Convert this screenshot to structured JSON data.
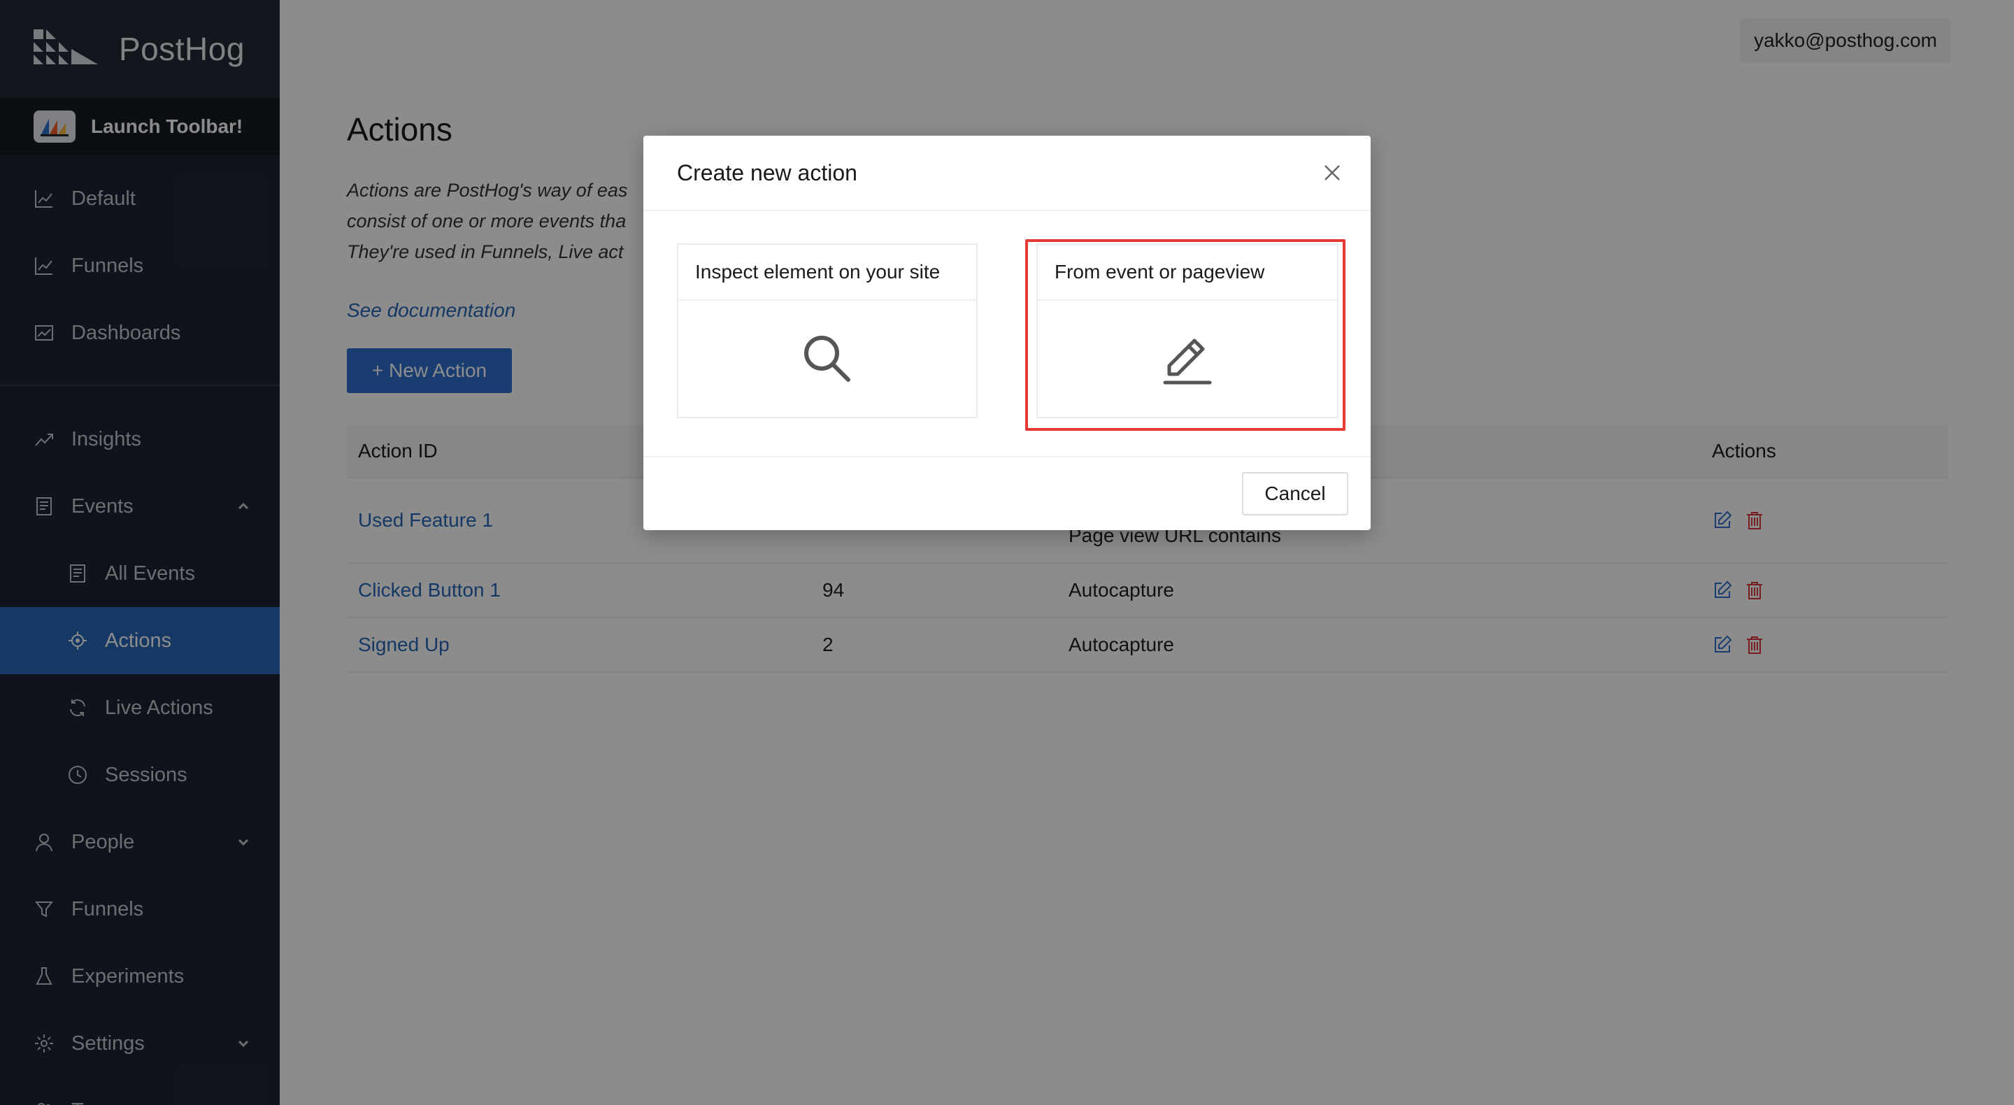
{
  "app": {
    "brand": "PostHog",
    "toolbar_label": "Launch Toolbar!"
  },
  "sidebar": {
    "items": [
      {
        "label": "Default",
        "icon": "line-chart-icon"
      },
      {
        "label": "Funnels",
        "icon": "line-chart-icon"
      },
      {
        "label": "Dashboards",
        "icon": "dashboard-icon"
      },
      {
        "label": "Insights",
        "icon": "trend-icon"
      },
      {
        "label": "Events",
        "icon": "events-icon",
        "expanded": true
      },
      {
        "label": "All Events",
        "icon": "list-icon"
      },
      {
        "label": "Actions",
        "icon": "target-icon",
        "active": true
      },
      {
        "label": "Live Actions",
        "icon": "refresh-icon"
      },
      {
        "label": "Sessions",
        "icon": "clock-icon"
      },
      {
        "label": "People",
        "icon": "user-icon"
      },
      {
        "label": "Funnels",
        "icon": "funnel-icon"
      },
      {
        "label": "Experiments",
        "icon": "flask-icon"
      },
      {
        "label": "Settings",
        "icon": "gear-icon"
      },
      {
        "label": "Team",
        "icon": "team-icon"
      }
    ]
  },
  "header": {
    "user_email": "yakko@posthog.com"
  },
  "page": {
    "title": "Actions",
    "description_line1": "Actions are PostHog's way of eas",
    "description_line2": "consist of one or more events tha",
    "description_line3": "They're used in Funnels, Live act",
    "doc_link": "See documentation",
    "new_action_label": "+ New Action"
  },
  "table": {
    "columns": [
      "Action ID",
      "Actions"
    ],
    "rows": [
      {
        "name": "Used Feature 1",
        "count": "",
        "type": "Page view URL contains"
      },
      {
        "name": "Clicked Button 1",
        "count": "94",
        "type": "Autocapture"
      },
      {
        "name": "Signed Up",
        "count": "2",
        "type": "Autocapture"
      }
    ]
  },
  "modal": {
    "title": "Create new action",
    "option_inspect": "Inspect element on your site",
    "option_event": "From event or pageview",
    "cancel_label": "Cancel"
  },
  "colors": {
    "sidebar_bg": "#1b2631",
    "active_nav": "#2767b6",
    "primary_button": "#2e6fce",
    "link": "#2767b6",
    "highlight_border": "#e53935",
    "delete_icon": "#d9363e"
  }
}
